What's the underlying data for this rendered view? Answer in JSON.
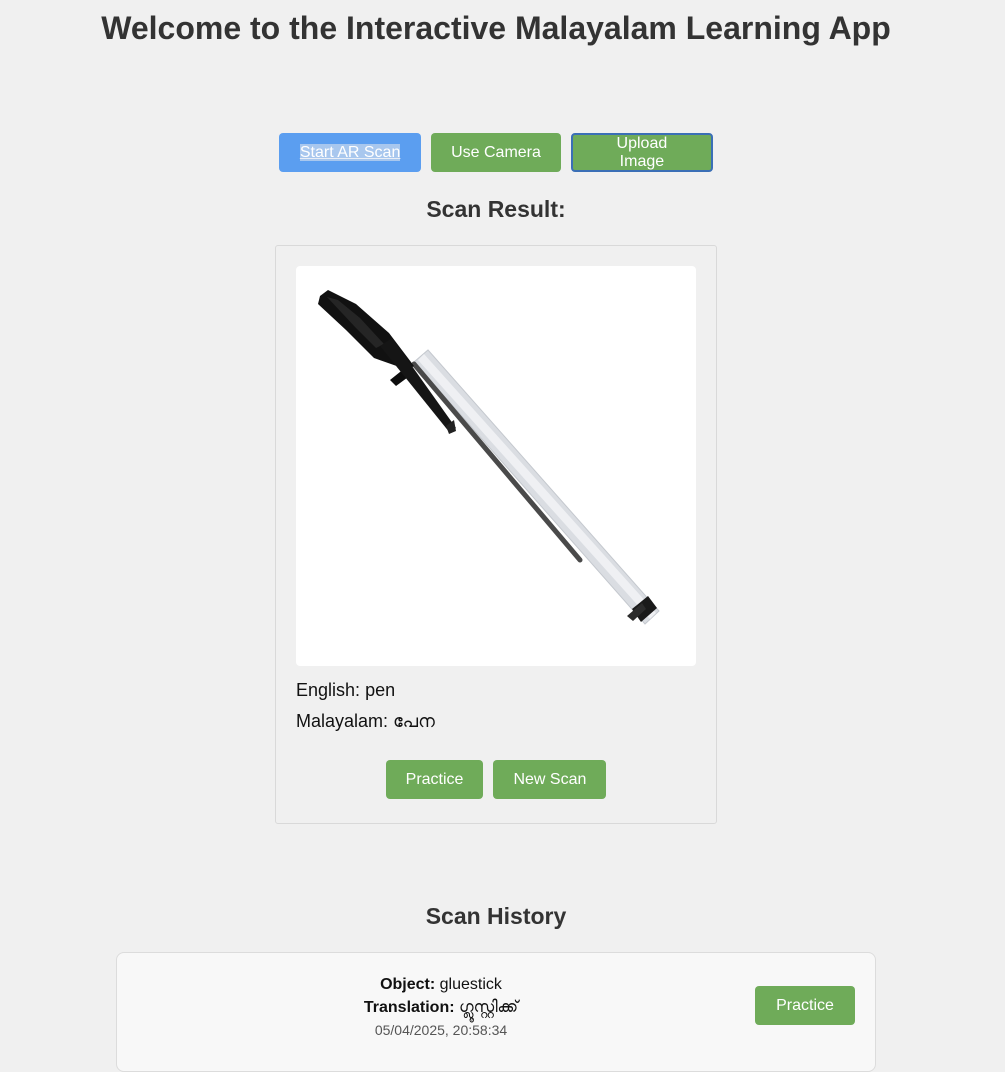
{
  "page": {
    "title": "Welcome to the Interactive Malayalam Learning App"
  },
  "controls": {
    "start_ar": "Start AR Scan",
    "use_camera": "Use Camera",
    "upload_image": "Upload Image"
  },
  "result": {
    "heading": "Scan Result:",
    "english_label": "English:",
    "english_value": "pen",
    "malayalam_label": "Malayalam:",
    "malayalam_value": "പേന",
    "practice": "Practice",
    "new_scan": "New Scan"
  },
  "history": {
    "heading": "Scan History",
    "items": [
      {
        "object_label": "Object:",
        "object_value": "gluestick",
        "translation_label": "Translation:",
        "translation_value": "ഗ്ലൂസ്റ്റിക്ക്",
        "timestamp": "05/04/2025, 20:58:34",
        "practice": "Practice"
      }
    ]
  },
  "colors": {
    "accent_blue": "#5b9ef0",
    "accent_green": "#6fab59",
    "background": "#f0f0f0"
  }
}
